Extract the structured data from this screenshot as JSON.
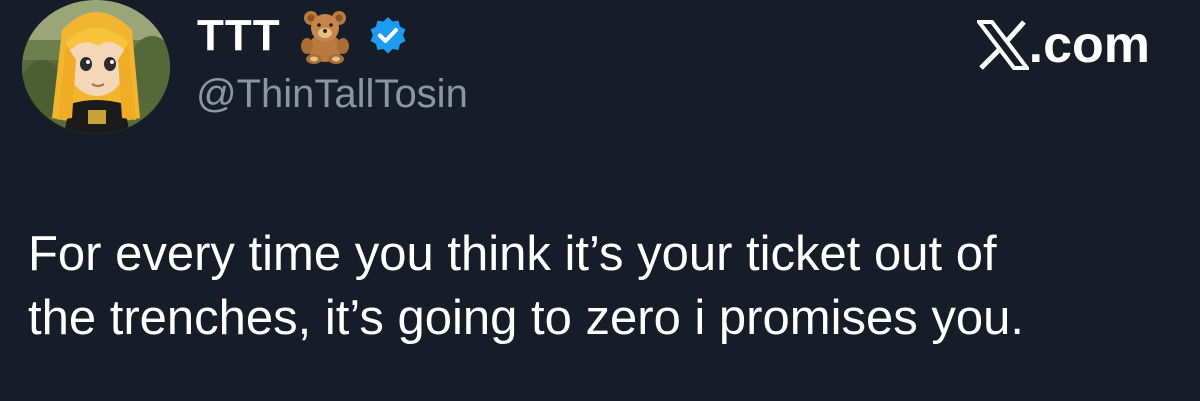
{
  "author": {
    "display_name": "TTT",
    "name_emoji": "teddy-bear-icon",
    "verified_badge": "verified-badge-icon",
    "handle": "@ThinTallTosin",
    "avatar": "profile-avatar"
  },
  "brand": {
    "logo": "x-logo-icon",
    "suffix": ".com"
  },
  "tweet": {
    "line_1": "For every time you think it’s your ticket out of",
    "line_2": "the trenches, it’s going to zero i promises you."
  },
  "colors": {
    "background": "#161d29",
    "text_primary": "#ffffff",
    "text_secondary": "#8a96a3",
    "verified_blue": "#1d9bf0"
  }
}
